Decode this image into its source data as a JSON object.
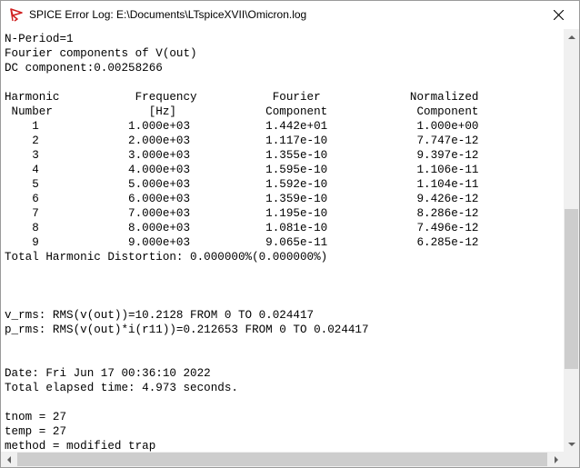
{
  "window": {
    "title": "SPICE Error Log: E:\\Documents\\LTspiceXVII\\Omicron.log"
  },
  "icons": {
    "app": "ltspice-app-icon",
    "close": "close-icon"
  },
  "colors": {
    "icon_red": "#d02020",
    "scroll_thumb": "#cdcdcd",
    "scroll_track": "#f0f0f0"
  },
  "log": {
    "lines": [
      "N-Period=1",
      "Fourier components of V(out)",
      "DC component:0.00258266",
      "",
      "Harmonic           Frequency           Fourier             Normalized",
      " Number              [Hz]             Component             Component",
      "    1             1.000e+03           1.442e+01             1.000e+00",
      "    2             2.000e+03           1.117e-10             7.747e-12",
      "    3             3.000e+03           1.355e-10             9.397e-12",
      "    4             4.000e+03           1.595e-10             1.106e-11",
      "    5             5.000e+03           1.592e-10             1.104e-11",
      "    6             6.000e+03           1.359e-10             9.426e-12",
      "    7             7.000e+03           1.195e-10             8.286e-12",
      "    8             8.000e+03           1.081e-10             7.496e-12",
      "    9             9.000e+03           9.065e-11             6.285e-12",
      "Total Harmonic Distortion: 0.000000%(0.000000%)",
      "",
      "",
      "",
      "v_rms: RMS(v(out))=10.2128 FROM 0 TO 0.024417",
      "p_rms: RMS(v(out)*i(r11))=0.212653 FROM 0 TO 0.024417",
      "",
      "",
      "Date: Fri Jun 17 00:36:10 2022",
      "Total elapsed time: 4.973 seconds.",
      "",
      "tnom = 27",
      "temp = 27",
      "method = modified trap"
    ]
  }
}
